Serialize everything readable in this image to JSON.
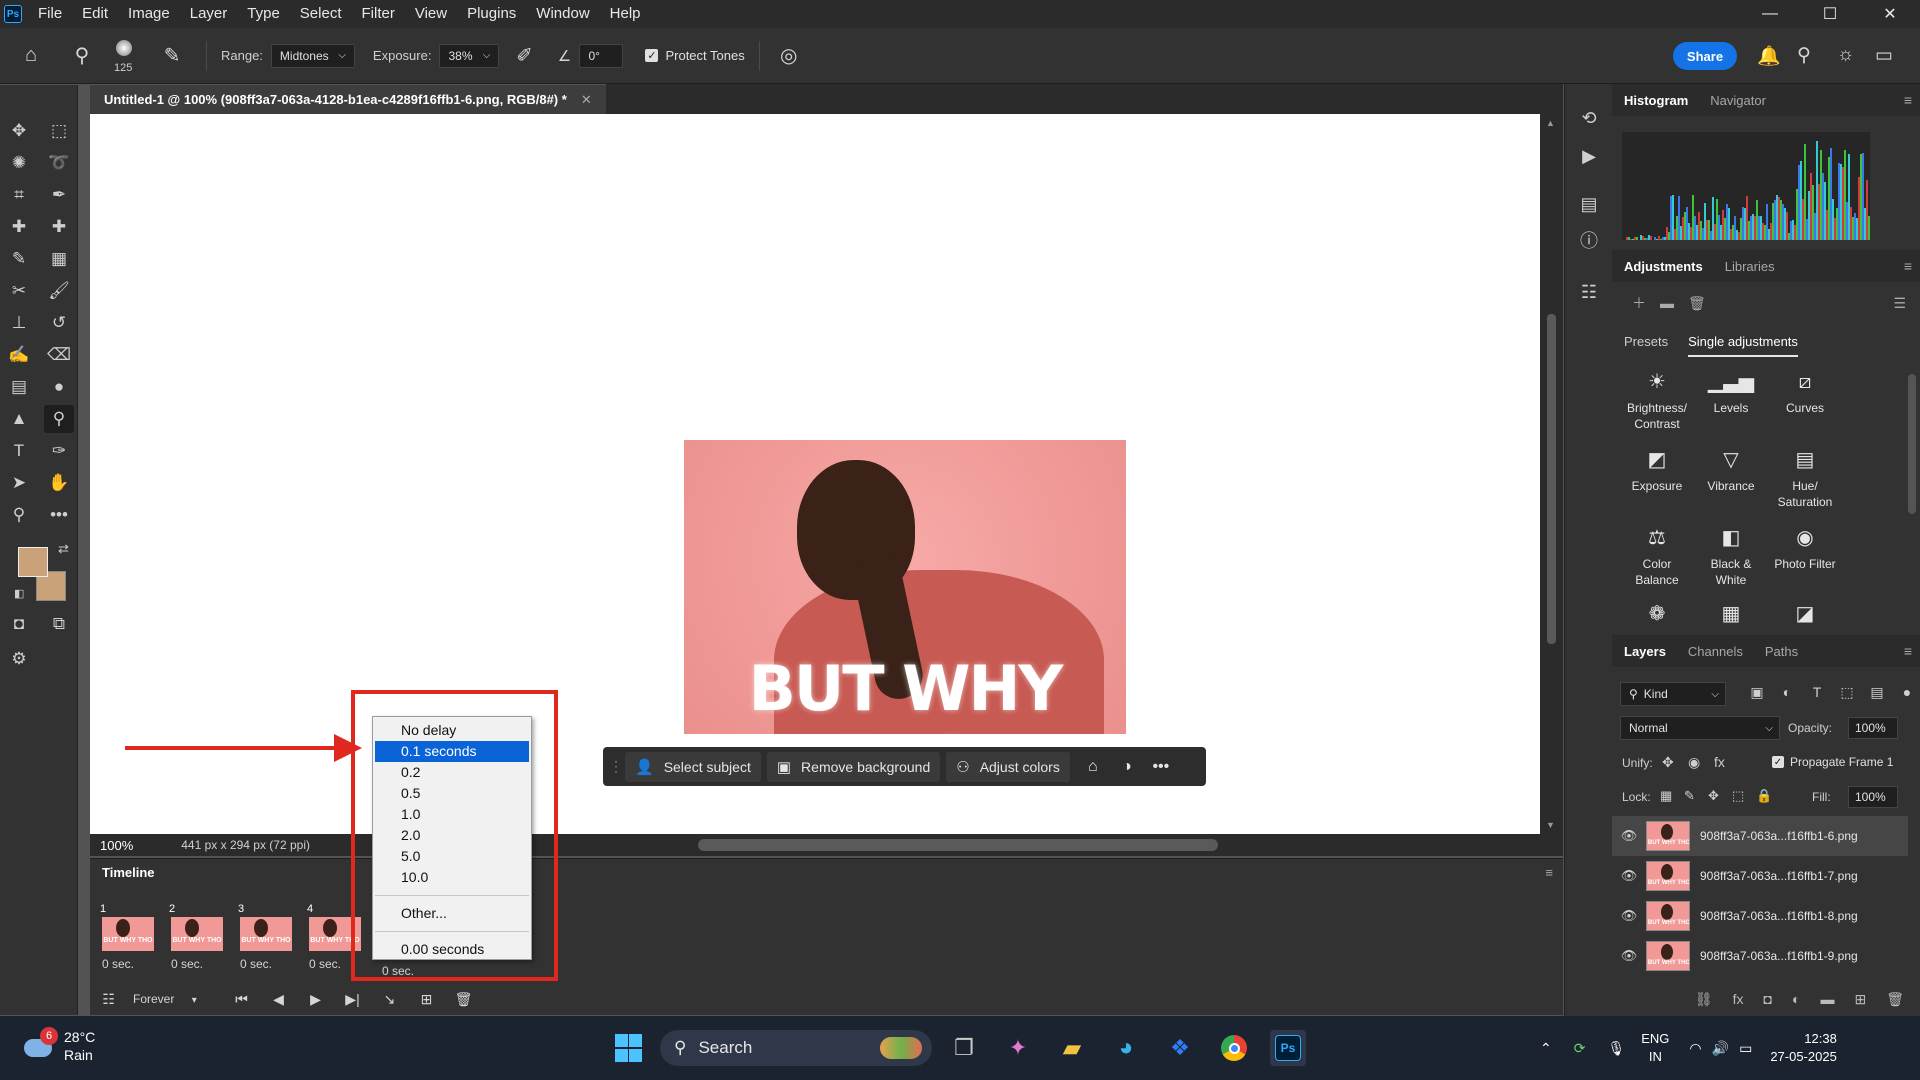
{
  "app": {
    "logo_text": "Ps"
  },
  "menu": [
    "File",
    "Edit",
    "Image",
    "Layer",
    "Type",
    "Select",
    "Filter",
    "View",
    "Plugins",
    "Window",
    "Help"
  ],
  "options": {
    "brush_size": "125",
    "range_label": "Range:",
    "range_value": "Midtones",
    "exposure_label": "Exposure:",
    "exposure_value": "38%",
    "angle_value": "0°",
    "protect_tones_label": "Protect Tones",
    "protect_tones_checked": true,
    "share_label": "Share"
  },
  "document": {
    "tab_title": "Untitled-1 @ 100% (908ff3a7-063a-4128-b1ea-c4289f16ffb1-6.png, RGB/8#) *",
    "image_text": "BUT WHY THO"
  },
  "contextual_bar": {
    "select_subject": "Select subject",
    "remove_background": "Remove background",
    "adjust_colors": "Adjust colors"
  },
  "status": {
    "zoom": "100%",
    "doc_info": "441 px x 294 px (72 ppi)"
  },
  "timeline": {
    "title": "Timeline",
    "frames": [
      {
        "num": "1",
        "delay": "0 sec."
      },
      {
        "num": "2",
        "delay": "0 sec."
      },
      {
        "num": "3",
        "delay": "0 sec."
      },
      {
        "num": "4",
        "delay": "0 sec."
      }
    ],
    "active_delay": "0 sec.",
    "loop": "Forever",
    "thumb_text": "BUT WHY THO"
  },
  "delay_menu": {
    "items": [
      "No delay",
      "0.1 seconds",
      "0.2",
      "0.5",
      "1.0",
      "2.0",
      "5.0",
      "10.0"
    ],
    "selected": "0.1 seconds",
    "other": "Other...",
    "current": "0.00 seconds"
  },
  "panels": {
    "histogram_tabs": [
      "Histogram",
      "Navigator"
    ],
    "adjust_tabs": [
      "Adjustments",
      "Libraries"
    ],
    "adjust_subtabs": [
      "Presets",
      "Single adjustments"
    ],
    "adjustments": [
      {
        "label": "Brightness/\nContrast",
        "icon": "sun-icon"
      },
      {
        "label": "Levels",
        "icon": "levels-icon"
      },
      {
        "label": "Curves",
        "icon": "curves-icon"
      },
      {
        "label": "Exposure",
        "icon": "exposure-icon"
      },
      {
        "label": "Vibrance",
        "icon": "vibrance-icon"
      },
      {
        "label": "Hue/\nSaturation",
        "icon": "hue-icon"
      },
      {
        "label": "Color\nBalance",
        "icon": "balance-icon"
      },
      {
        "label": "Black &\nWhite",
        "icon": "bw-icon"
      },
      {
        "label": "Photo Filter",
        "icon": "camera-icon"
      }
    ],
    "layers_tabs": [
      "Layers",
      "Channels",
      "Paths"
    ],
    "kind_label": "Kind",
    "blend_mode": "Normal",
    "opacity_label": "Opacity:",
    "opacity_value": "100%",
    "unify_label": "Unify:",
    "propagate_label": "Propagate Frame 1",
    "lock_label": "Lock:",
    "fill_label": "Fill:",
    "fill_value": "100%",
    "layers": [
      "908ff3a7-063a...f16ffb1-6.png",
      "908ff3a7-063a...f16ffb1-7.png",
      "908ff3a7-063a...f16ffb1-8.png",
      "908ff3a7-063a...f16ffb1-9.png"
    ]
  },
  "taskbar": {
    "weather_temp": "28°C",
    "weather_desc": "Rain",
    "weather_badge": "6",
    "search_placeholder": "Search",
    "lang_top": "ENG",
    "lang_bottom": "IN",
    "time": "12:38",
    "date": "27-05-2025"
  },
  "colors": {
    "accent_blue": "#1473e6",
    "annotation_red": "#e0281f",
    "menu_selected": "#0a64d8",
    "foreground_swatch": "#c9a27a",
    "background_swatch": "#c9a27a"
  }
}
